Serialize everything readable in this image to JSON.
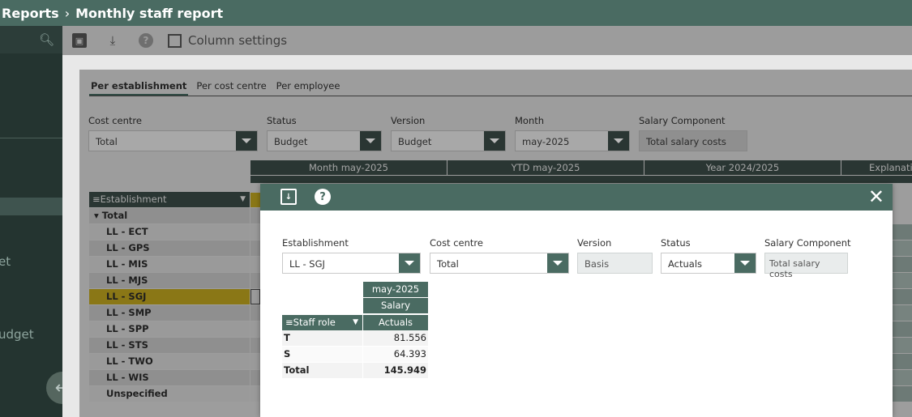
{
  "breadcrumb": {
    "parent": "Reports",
    "separator": "›",
    "current": "Monthly staff report"
  },
  "sidebar": {
    "item_1": "et",
    "item_2": "udget"
  },
  "toolbar": {
    "column_settings": "Column settings"
  },
  "tabs": [
    {
      "label": "Per establishment",
      "active": true
    },
    {
      "label": "Per cost centre",
      "active": false
    },
    {
      "label": "Per employee",
      "active": false
    }
  ],
  "filters": {
    "cost_centre": {
      "label": "Cost centre",
      "value": "Total"
    },
    "status": {
      "label": "Status",
      "value": "Budget"
    },
    "version": {
      "label": "Version",
      "value": "Budget"
    },
    "month": {
      "label": "Month",
      "value": "may-2025"
    },
    "salary_component": {
      "label": "Salary Component",
      "value": "Total salary costs"
    }
  },
  "grid": {
    "column_groups": [
      "Month may-2025",
      "YTD may-2025",
      "Year 2024/2025",
      "Explanatio"
    ],
    "row_header": "Establishment",
    "rows": [
      "Total",
      "LL - ECT",
      "LL - GPS",
      "LL - MIS",
      "LL - MJS",
      "LL - SGJ",
      "LL - SMP",
      "LL - SPP",
      "LL - STS",
      "LL - TWO",
      "LL - WIS",
      "Unspecified"
    ],
    "highlighted_row": "LL - SGJ"
  },
  "modal": {
    "filters": {
      "establishment": {
        "label": "Establishment",
        "value": "LL - SGJ"
      },
      "cost_centre": {
        "label": "Cost centre",
        "value": "Total"
      },
      "version": {
        "label": "Version",
        "value": "Basis"
      },
      "status": {
        "label": "Status",
        "value": "Actuals"
      },
      "salary_component": {
        "label": "Salary Component",
        "value": "Total salary costs"
      }
    },
    "table": {
      "period": "may-2025",
      "measure": "Salary",
      "column": "Actuals",
      "row_header": "Staff role",
      "rows": [
        {
          "label": "T",
          "value": "81.556"
        },
        {
          "label": "S",
          "value": "64.393"
        },
        {
          "label": "Total",
          "value": "145.949"
        }
      ]
    }
  },
  "colors": {
    "header_green": "#4a6b62",
    "highlight_yellow": "#8a7716"
  }
}
